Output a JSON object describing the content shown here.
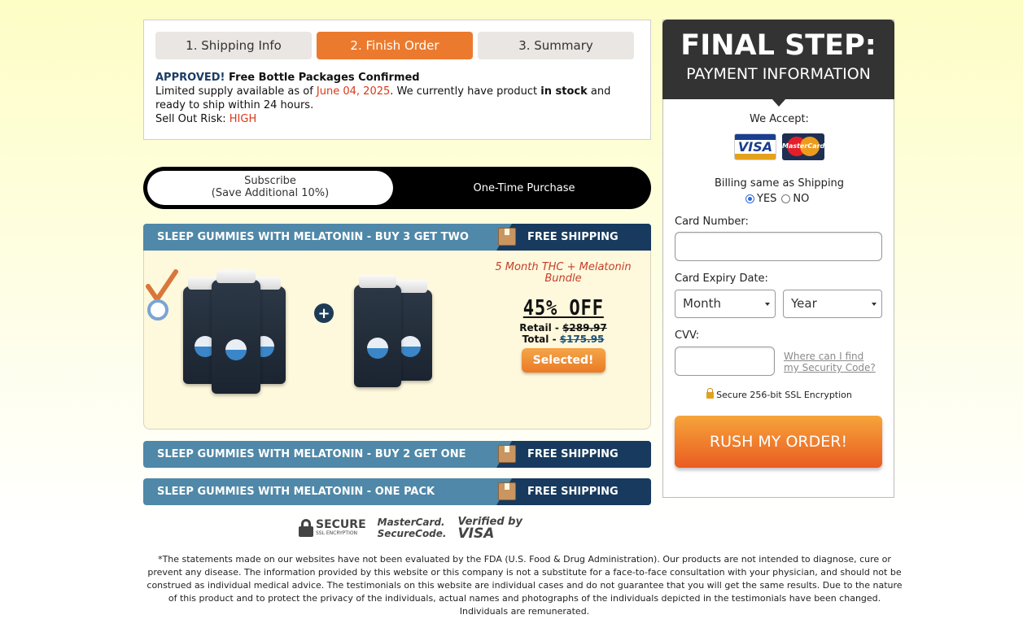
{
  "steps": {
    "tabs": [
      {
        "label": "1. Shipping Info",
        "active": false
      },
      {
        "label": "2. Finish Order",
        "active": true
      },
      {
        "label": "3. Summary",
        "active": false
      }
    ]
  },
  "approval": {
    "approved": "APPROVED!",
    "confirmed": " Free Bottle Packages Confirmed",
    "supply_prefix": "Limited supply available as of ",
    "date": "June 04, 2025",
    "supply_mid": ". We currently have product ",
    "in_stock": "in stock",
    "supply_suffix": " and ready to ship within 24 hours.",
    "risk_label": "Sell Out Risk: ",
    "risk_value": "HIGH"
  },
  "purchase_toggle": {
    "subscribe_line1": "Subscribe",
    "subscribe_line2": "(Save Additional 10%)",
    "one_time": "One-Time Purchase"
  },
  "packages": [
    {
      "title": "SLEEP GUMMIES WITH MELATONIN - BUY 3 GET TWO",
      "shipping": "FREE SHIPPING",
      "bundle": "5 Month THC + Melatonin Bundle",
      "discount": "45% OFF",
      "retail_label": "Retail - ",
      "retail_price": "$289.97",
      "total_label": "Total - ",
      "total_price": "$175.95",
      "button": "Selected!"
    },
    {
      "title": "SLEEP GUMMIES WITH MELATONIN - BUY 2 GET ONE",
      "shipping": "FREE SHIPPING"
    },
    {
      "title": "SLEEP GUMMIES WITH MELATONIN - ONE PACK",
      "shipping": "FREE SHIPPING"
    }
  ],
  "trust": {
    "secure_title": "SECURE",
    "secure_sub": "SSL ENCRYPTION",
    "mc_line1": "MasterCard.",
    "mc_line2": "SecureCode.",
    "visa_line1": "Verified by",
    "visa_line2": "VISA"
  },
  "disclaimer": "*The statements made on our websites have not been evaluated by the FDA (U.S. Food & Drug Administration). Our products are not intended to diagnose, cure or prevent any disease. The information provided by this website or this company is not a substitute for a face-to-face consultation with your physician, and should not be construed as individual medical advice. The testimonials on this website are individual cases and do not guarantee that you will get the same results. Due to the nature of this product and to protect the privacy of the individuals, actual names and photographs of the individuals depicted in the testimonials have been changed. Individuals are remunerated.",
  "payment": {
    "heading": "FINAL STEP:",
    "subheading": "PAYMENT INFORMATION",
    "we_accept": "We Accept:",
    "visa": "VISA",
    "mastercard": "MasterCard",
    "billing_label": "Billing same as Shipping",
    "billing_yes": "YES",
    "billing_no": "NO",
    "card_number_label": "Card Number:",
    "card_number_value": "",
    "expiry_label": "Card Expiry Date:",
    "month": "Month",
    "year": "Year",
    "cvv_label": "CVV:",
    "cvv_value": "",
    "cvv_help_line1": "Where can I find",
    "cvv_help_line2": "my Security Code?",
    "ssl": "Secure 256-bit SSL Encryption",
    "submit": "RUSH MY ORDER!"
  },
  "colors": {
    "accent_orange": "#ec7a2e",
    "header_blue": "#4f88a8",
    "header_navy": "#173a5e",
    "alert_red": "#d9391a"
  }
}
